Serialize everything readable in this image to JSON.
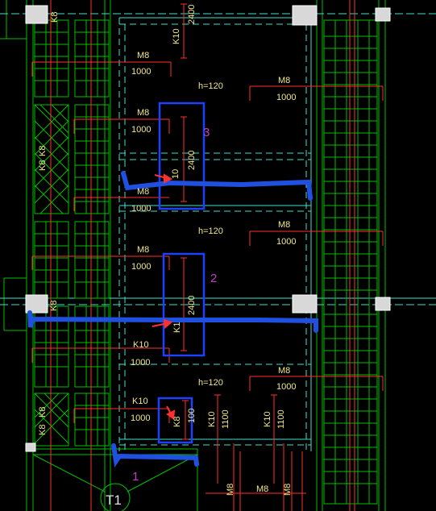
{
  "drawing": {
    "labels": {
      "k8_top": "K8",
      "k8_left1": "K8",
      "k8_left2": "K8",
      "k8_mid": "K8",
      "k8_bottom_left1": "K8",
      "k8_bottom_left2": "K8",
      "k8_box1": "K8",
      "k10_top": "K10",
      "k10_box3": "10",
      "k10_box2": "K1",
      "k10_lower": "K10",
      "k10_bottom": "K10",
      "k10_vert1": "K10",
      "k10_vert2": "K10",
      "len_2400_top": "2400",
      "len_2400_box3": "2400",
      "len_2400_box2": "2400",
      "len_1000_box1": "100",
      "len_1100_a": "1100",
      "len_1100_b": "1100",
      "m8_1": "M8",
      "m8_2": "M8",
      "m8_3": "M8",
      "m8_4": "M8",
      "m8_5": "M8",
      "m8_6": "M8",
      "m8_bottom1": "M8",
      "m8_bottom2": "M8",
      "m8_bottom3": "M8",
      "v1000_1": "1000",
      "v1000_2": "1000",
      "v1000_3": "1000",
      "v1000_4": "1000",
      "v1000_5": "1000",
      "v1000_6": "1000",
      "v1000_7": "1000",
      "v1000_8": "1000",
      "h120_1": "h=120",
      "h120_2": "h=120",
      "h120_3": "h=120",
      "stair_tag": "T1"
    },
    "annotations": {
      "n1": "1",
      "n2": "2",
      "n3": "3"
    },
    "colors": {
      "background": "#000000",
      "text": "#f0e68c",
      "rebar": "#ff3030",
      "wall": "#00c000",
      "grid": "#40e0d0",
      "column": "#e0e0e0",
      "markup_box": "#2040ff",
      "markup_stroke": "#2050e0",
      "annotation": "#c040c0"
    }
  }
}
